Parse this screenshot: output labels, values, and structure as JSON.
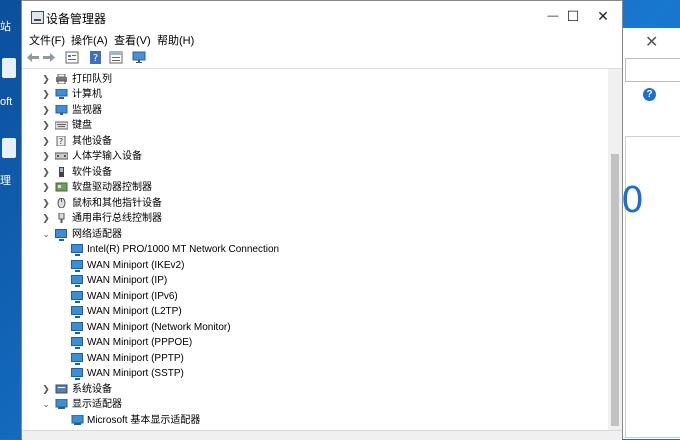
{
  "desktop": {
    "label_top": "站",
    "label_mid": "oft",
    "label_bottom": "理"
  },
  "background_window": {
    "close_glyph": "✕",
    "help_glyph": "?",
    "big_text": "0"
  },
  "window": {
    "title": "设备管理器",
    "minimize_glyph": "—",
    "maximize_glyph": "☐",
    "close_glyph": "✕"
  },
  "menu": [
    {
      "label": "文件(F)"
    },
    {
      "label": "操作(A)"
    },
    {
      "label": "查看(V)"
    },
    {
      "label": "帮助(H)"
    }
  ],
  "toolbar": {
    "back_icon": "arrow-left-icon",
    "forward_icon": "arrow-right-icon",
    "properties_icon": "properties-icon",
    "help_icon": "help-icon",
    "view_icon": "view-icon",
    "monitor_icon": "monitor-icon"
  },
  "tree": {
    "categories_top": [
      {
        "label": "打印队列",
        "icon": "printer-icon"
      },
      {
        "label": "计算机",
        "icon": "computer-icon"
      },
      {
        "label": "监视器",
        "icon": "monitor-icon"
      },
      {
        "label": "键盘",
        "icon": "keyboard-icon"
      },
      {
        "label": "其他设备",
        "icon": "unknown-device-icon"
      },
      {
        "label": "人体学输入设备",
        "icon": "hid-icon"
      },
      {
        "label": "软件设备",
        "icon": "software-device-icon"
      },
      {
        "label": "软盘驱动器控制器",
        "icon": "controller-icon"
      },
      {
        "label": "鼠标和其他指针设备",
        "icon": "mouse-icon"
      },
      {
        "label": "通用串行总线控制器",
        "icon": "usb-icon"
      }
    ],
    "network_category": {
      "label": "网络适配器",
      "icon": "network-adapter-icon"
    },
    "network_children": [
      {
        "label": "Intel(R) PRO/1000 MT Network Connection"
      },
      {
        "label": "WAN Miniport (IKEv2)"
      },
      {
        "label": "WAN Miniport (IP)"
      },
      {
        "label": "WAN Miniport (IPv6)"
      },
      {
        "label": "WAN Miniport (L2TP)"
      },
      {
        "label": "WAN Miniport (Network Monitor)"
      },
      {
        "label": "WAN Miniport (PPPOE)"
      },
      {
        "label": "WAN Miniport (PPTP)"
      },
      {
        "label": "WAN Miniport (SSTP)"
      }
    ],
    "system_category": {
      "label": "系统设备",
      "icon": "system-device-icon"
    },
    "display_category": {
      "label": "显示适配器",
      "icon": "display-adapter-icon"
    },
    "display_children": [
      {
        "label": "Microsoft 基本显示适配器"
      }
    ]
  }
}
